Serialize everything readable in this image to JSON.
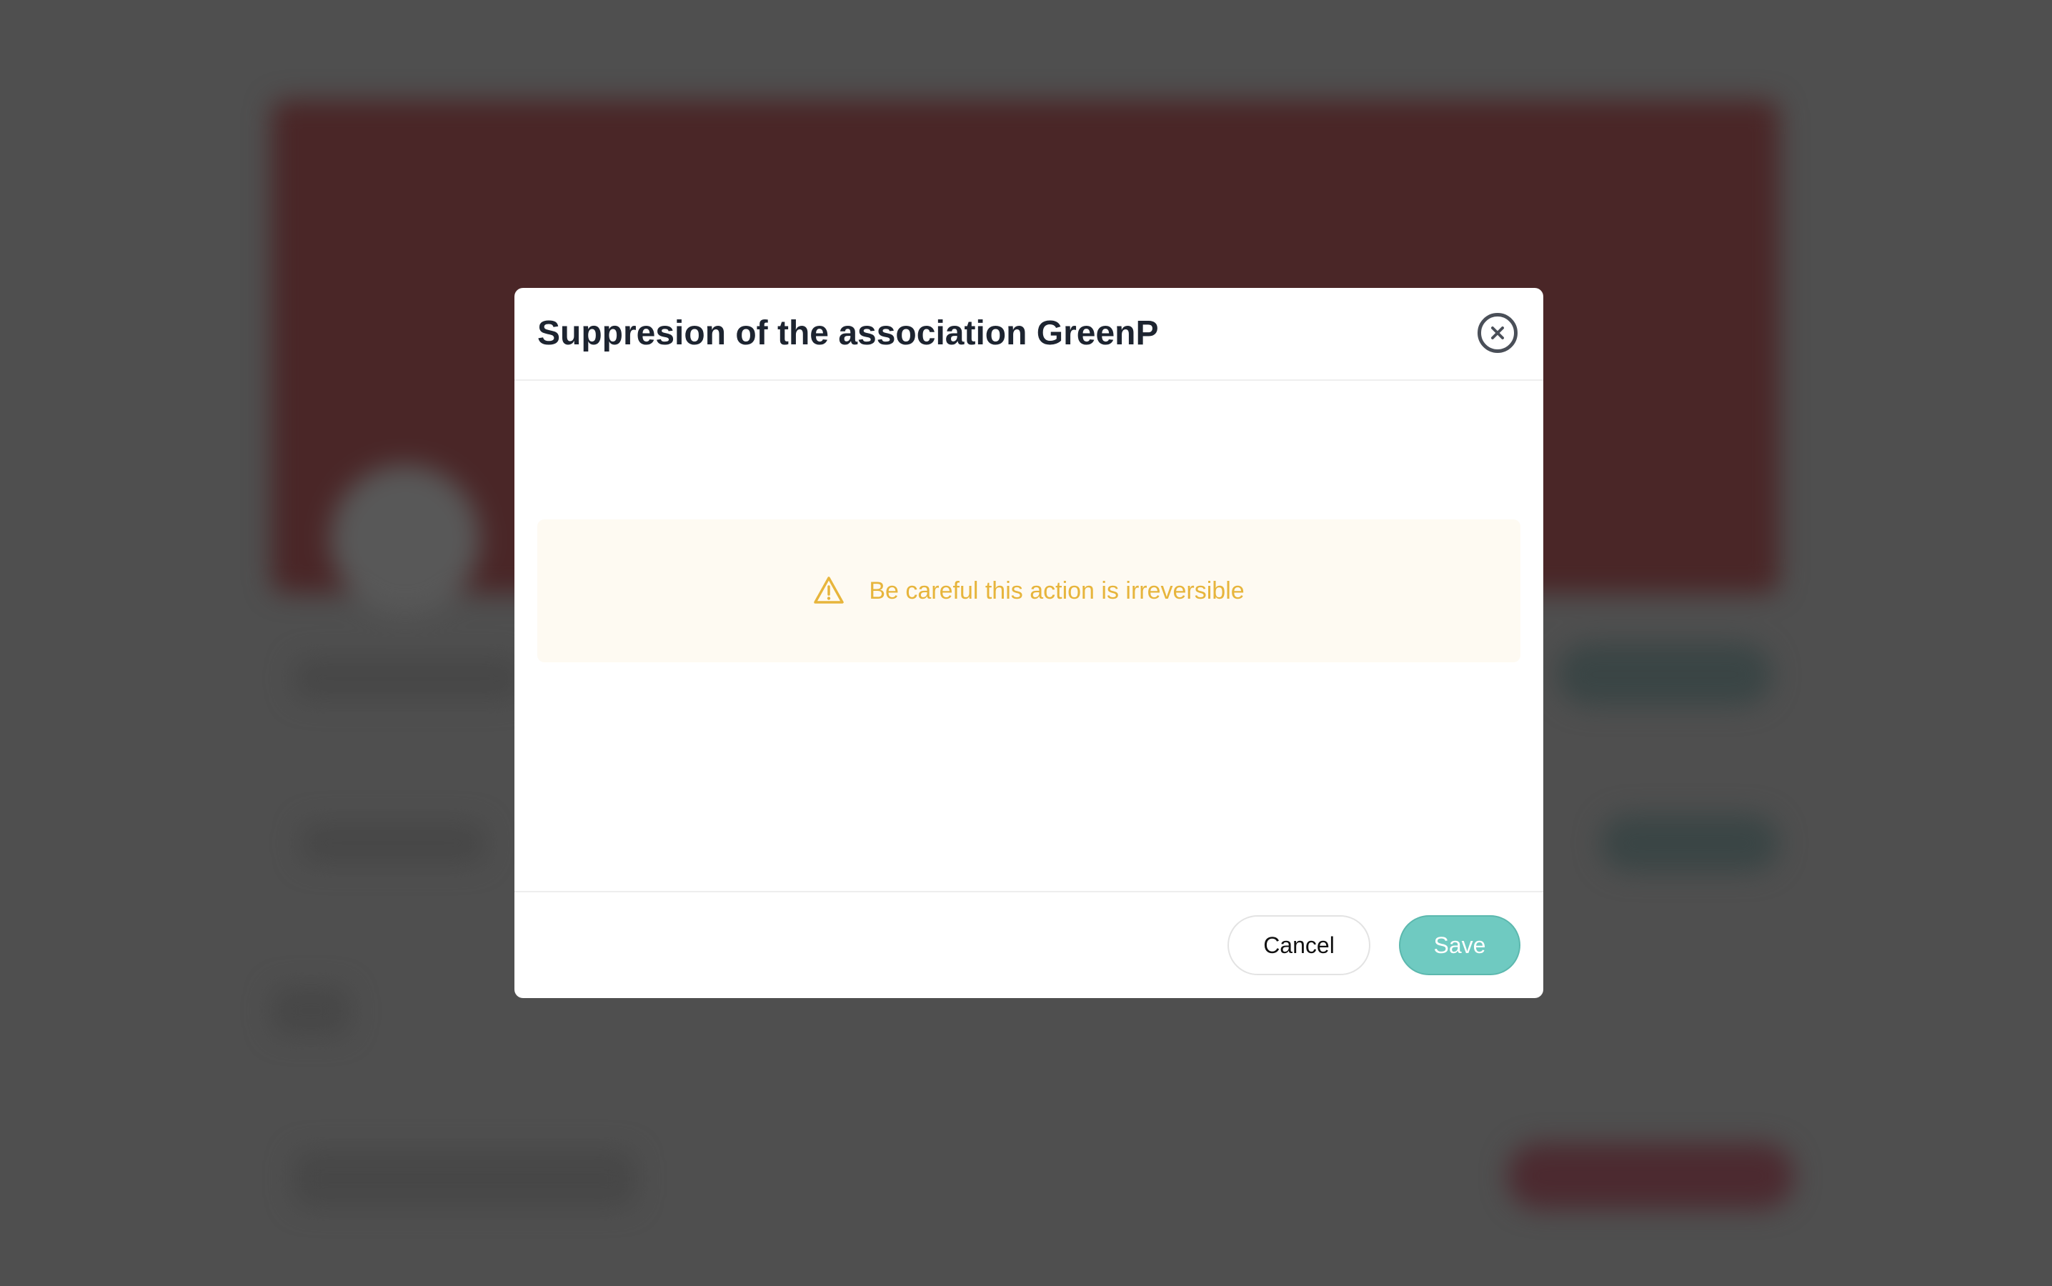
{
  "modal": {
    "title": "Suppresion of the association GreenP",
    "close_icon": "close-circle-icon",
    "alert": {
      "icon": "warning-triangle-icon",
      "text": "Be careful this action is irreversible",
      "color": "#e7b53c",
      "background": "#fefaf2"
    },
    "footer": {
      "cancel_label": "Cancel",
      "save_label": "Save",
      "save_color": "#6fcac1"
    }
  },
  "overlay_color": "#4f4f4f"
}
